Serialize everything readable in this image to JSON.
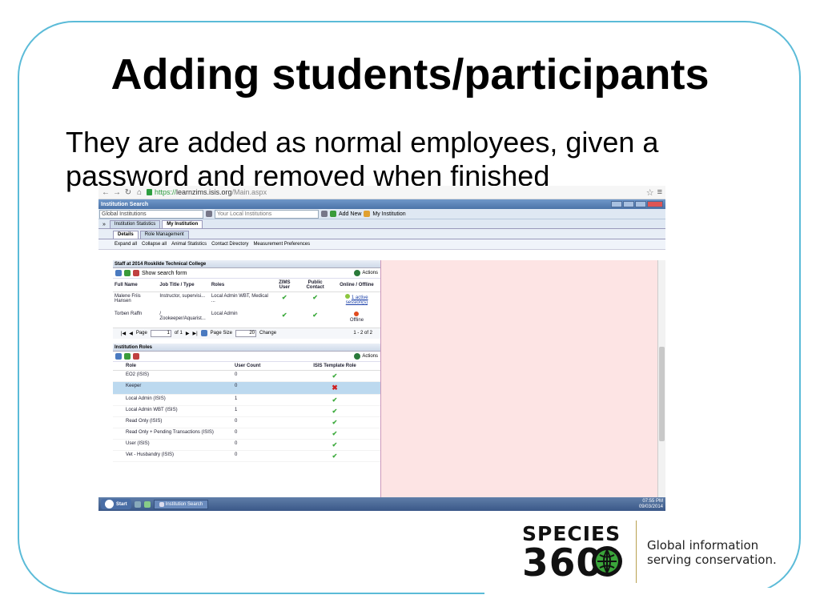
{
  "slide": {
    "title": "Adding students/participants",
    "body": "They are added as normal employees, given a password and removed when finished"
  },
  "browser": {
    "url_prefix": "https://",
    "url_domain": "learnzims.isis.org",
    "url_path": "/Main.aspx"
  },
  "window": {
    "title": "Institution Search"
  },
  "search_bar": {
    "global_value": "Global Institutions",
    "local_placeholder": "Your Local Institutions",
    "add_new": "Add New",
    "my_institution": "My Institution"
  },
  "tabs": [
    "Institution Statistics",
    "My Institution"
  ],
  "subtabs": [
    "Details",
    "Role Management"
  ],
  "toolbar": [
    "Expand all",
    "Collapse all",
    "Animal Statistics",
    "Contact Directory",
    "Measurement Preferences"
  ],
  "staff_panel": {
    "title": "Staff at 2014 Roskilde Technical College",
    "show_search": "Show search form",
    "actions": "Actions",
    "columns": [
      "Full Name",
      "Job Title / Type",
      "Roles",
      "ZIMS User",
      "Public Contact",
      "Online / Offline"
    ],
    "rows": [
      {
        "name": "Malene Friis Hansen",
        "job": "Instructor, supervisi...",
        "roles": "Local Admin WBT, Medical ...",
        "status": "1 active session(s)"
      },
      {
        "name": "Torben Raffn",
        "job": "/ Zookeeper/Aquarist...",
        "roles": "Local Admin",
        "status": "Offline"
      }
    ],
    "pager": {
      "page_label": "Page",
      "page": "1",
      "of": "of 1",
      "page_size_label": "Page Size",
      "page_size": "20",
      "change": "Change",
      "summary": "1 - 2 of 2"
    }
  },
  "roles_panel": {
    "title": "Institution Roles",
    "actions": "Actions",
    "columns": [
      "Role",
      "User Count",
      "ISIS Template Role"
    ],
    "rows": [
      {
        "role": "EO2 (ISIS)",
        "count": "0",
        "template": true
      },
      {
        "role": "Keeper",
        "count": "0",
        "template": false
      },
      {
        "role": "Local Admin (ISIS)",
        "count": "1",
        "template": true
      },
      {
        "role": "Local Admin WBT (ISIS)",
        "count": "1",
        "template": true
      },
      {
        "role": "Read Only (ISIS)",
        "count": "0",
        "template": true
      },
      {
        "role": "Read Only + Pending Transactions (ISIS)",
        "count": "0",
        "template": true
      },
      {
        "role": "User (ISIS)",
        "count": "0",
        "template": true
      },
      {
        "role": "Vet - Husbandry (ISIS)",
        "count": "0",
        "template": true
      }
    ]
  },
  "taskbar": {
    "start": "Start",
    "item": "Institution Search",
    "time": "07:55 PM",
    "date": "09/03/2014"
  },
  "logo": {
    "species": "SPECIES",
    "number": "360",
    "tagline_1": "Global information",
    "tagline_2": "serving conservation."
  },
  "colors": {
    "frame": "#5bbbd8",
    "title_bar": "#4b73a8",
    "right_pane": "#fde4e4",
    "selected_row": "#bcd9ef",
    "check": "#3caa3c",
    "cross": "#d02020"
  }
}
